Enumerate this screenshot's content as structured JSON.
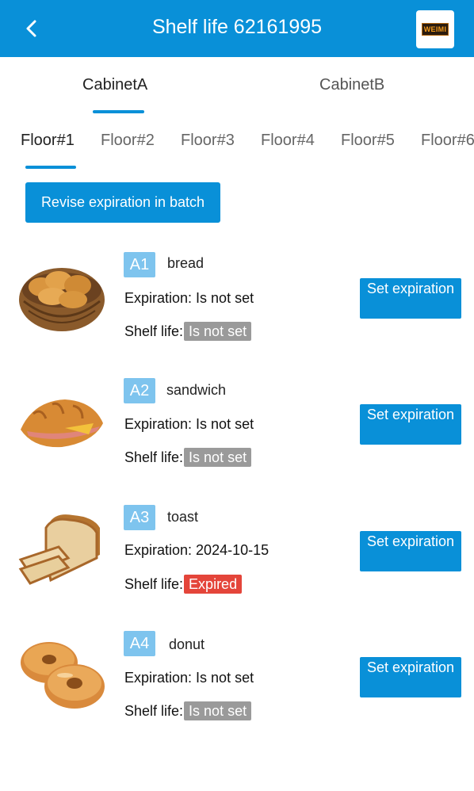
{
  "header": {
    "title": "Shelf life 62161995",
    "logo_text": "WEIMI"
  },
  "cabinets": [
    {
      "label": "CabinetA",
      "active": true
    },
    {
      "label": "CabinetB",
      "active": false
    }
  ],
  "floors": [
    {
      "label": "Floor#1",
      "active": true
    },
    {
      "label": "Floor#2",
      "active": false
    },
    {
      "label": "Floor#3",
      "active": false
    },
    {
      "label": "Floor#4",
      "active": false
    },
    {
      "label": "Floor#5",
      "active": false
    },
    {
      "label": "Floor#6",
      "active": false
    }
  ],
  "batch_button": "Revise expiration in batch",
  "labels": {
    "shelf_life": "Shelf life:",
    "set_button": "Set expiration"
  },
  "items": [
    {
      "code": "A1",
      "name": "bread",
      "expiration": "Expiration: Is not set",
      "status": "Is not set",
      "status_color": "#9a9a9a",
      "icon": "bread-basket-icon"
    },
    {
      "code": "A2",
      "name": "sandwich",
      "expiration": "Expiration: Is not set",
      "status": "Is not set",
      "status_color": "#9a9a9a",
      "icon": "croissant-sandwich-icon"
    },
    {
      "code": "A3",
      "name": "toast",
      "expiration": "Expiration: 2024-10-15",
      "status": "Expired",
      "status_color": "#e4453a",
      "icon": "sliced-toast-icon"
    },
    {
      "code": "A4",
      "name": "donut",
      "expiration": "Expiration: Is not set",
      "status": "Is not set",
      "status_color": "#9a9a9a",
      "icon": "donuts-icon"
    }
  ],
  "colors": {
    "primary": "#0990d8",
    "badge": "#7ec4ee",
    "muted_tag": "#9a9a9a",
    "expired_tag": "#e4453a"
  }
}
